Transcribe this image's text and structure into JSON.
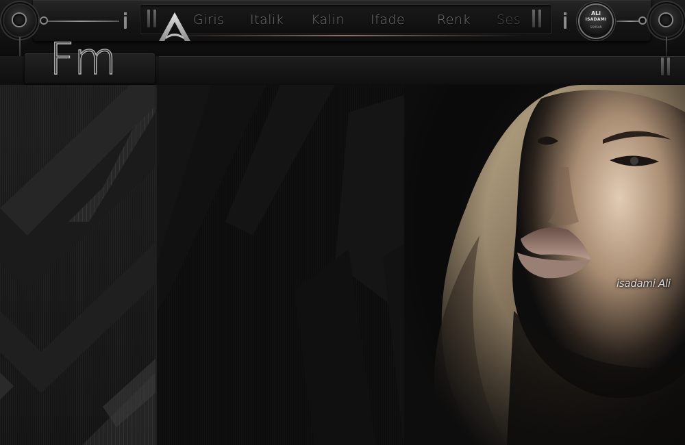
{
  "menu": {
    "items": [
      {
        "label": "Giris"
      },
      {
        "label": "Italik"
      },
      {
        "label": "Kalin"
      },
      {
        "label": "Ifade"
      },
      {
        "label": "Renk"
      },
      {
        "label": "Ses"
      }
    ]
  },
  "logo": {
    "letter": "A"
  },
  "badge": {
    "line1": "ALi",
    "line2": "ISADAMI",
    "line3": "SAYISAN"
  },
  "tab": {
    "label": "Fm"
  },
  "artwork": {
    "signature": "isadami Ali"
  },
  "colors": {
    "background": "#0b0b0b",
    "chrome": "#1c1c1c",
    "menu_text": "#707070",
    "accent_metal": "#9a9a9a",
    "skin_highlight": "#d9c2aa",
    "hair": "#a08e72"
  },
  "icons": {
    "left_knob": "knob-icon",
    "right_knob": "knob-icon",
    "pause_left": "pause-icon",
    "pause_right": "pause-icon",
    "tab_pause": "pause-icon"
  }
}
